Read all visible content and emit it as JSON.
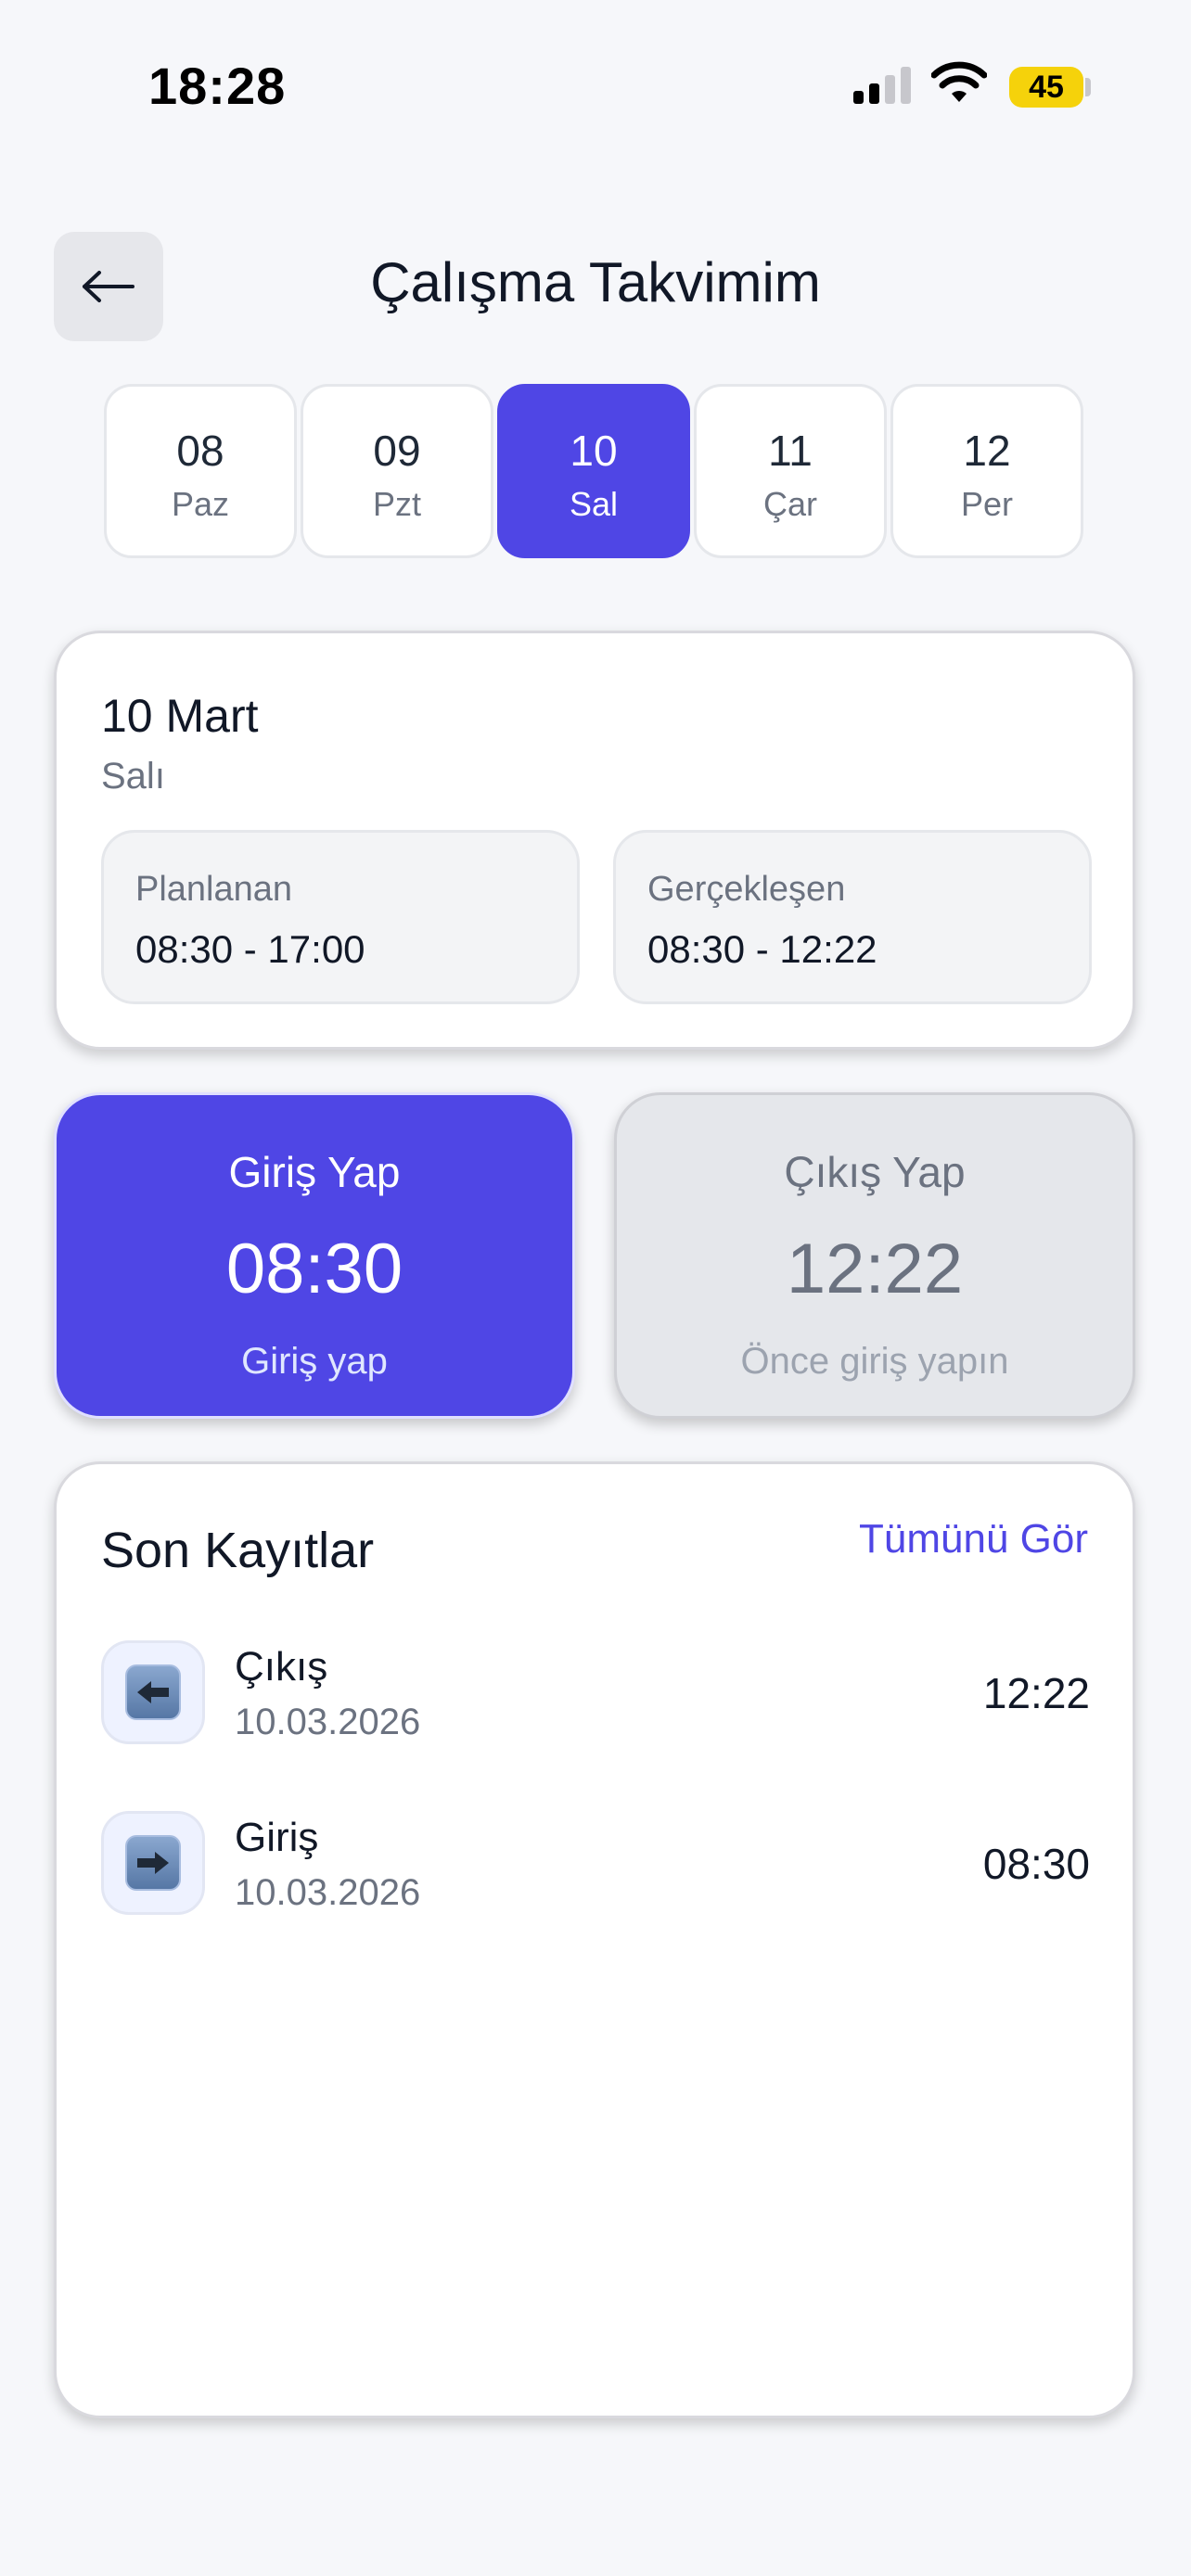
{
  "status_bar": {
    "time": "18:28",
    "battery": "45",
    "icons": [
      "signal-icon",
      "wifi-icon",
      "battery-icon"
    ],
    "battery_color": "#f5d20b"
  },
  "header": {
    "back_icon": "arrow-left-icon",
    "title": "Çalışma Takvimim"
  },
  "days": [
    {
      "num": "08",
      "name": "Paz",
      "selected": false
    },
    {
      "num": "09",
      "name": "Pzt",
      "selected": false
    },
    {
      "num": "10",
      "name": "Sal",
      "selected": true
    },
    {
      "num": "11",
      "name": "Çar",
      "selected": false
    },
    {
      "num": "12",
      "name": "Per",
      "selected": false
    }
  ],
  "date_card": {
    "title": "10 Mart",
    "weekday": "Salı",
    "planned": {
      "label": "Planlanan",
      "value": "08:30 - 17:00"
    },
    "actual": {
      "label": "Gerçekleşen",
      "value": "08:30 - 12:22"
    }
  },
  "checkin": {
    "title": "Giriş Yap",
    "time": "08:30",
    "subtitle": "Giriş yap"
  },
  "checkout": {
    "title": "Çıkış Yap",
    "time": "12:22",
    "subtitle": "Önce giriş yapın"
  },
  "records": {
    "title": "Son Kayıtlar",
    "see_all": "Tümünü Gör",
    "items": [
      {
        "type": "Çıkış",
        "date": "10.03.2026",
        "time": "12:22",
        "icon": "arrow-left-box-icon"
      },
      {
        "type": "Giriş",
        "date": "10.03.2026",
        "time": "08:30",
        "icon": "arrow-right-box-icon"
      }
    ]
  },
  "colors": {
    "accent": "#4f46e5",
    "background": "#f6f7fa"
  }
}
